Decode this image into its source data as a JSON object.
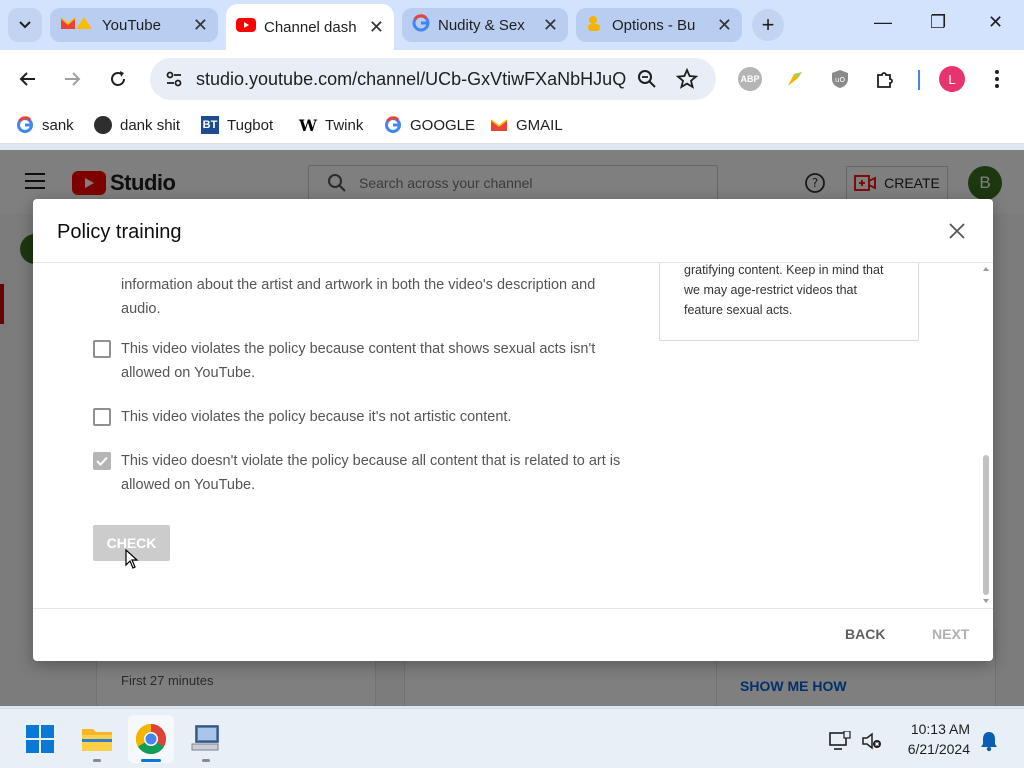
{
  "browser": {
    "tabs": [
      {
        "label": "YouTube",
        "icon": "gmail-youtube-favicon",
        "active": false
      },
      {
        "label": "Channel dash",
        "icon": "youtube-favicon",
        "active": true
      },
      {
        "label": "Nudity & Sex",
        "icon": "google-favicon",
        "active": false
      },
      {
        "label": "Options - Bu",
        "icon": "extension-favicon",
        "active": false
      }
    ],
    "close_glyph": "✕",
    "new_tab_glyph": "+",
    "minimize_glyph": "—",
    "restore_glyph": "❐",
    "window_close_glyph": "✕",
    "url": "studio.youtube.com/channel/UCb-GxVtiwFXaNbHJuQ...",
    "ext_abp_label": "ABP",
    "ext_ub_label": "uO",
    "profile_initial": "L"
  },
  "bookmarks": [
    {
      "label": "sank",
      "icon": "google-icon"
    },
    {
      "label": "dank shit",
      "icon": "dank-icon"
    },
    {
      "label": "Tugbot",
      "icon": "bt-icon",
      "badge": "BT"
    },
    {
      "label": "Twink",
      "icon": "wikipedia-icon",
      "badge": "W"
    },
    {
      "label": "GOOGLE",
      "icon": "google-icon"
    },
    {
      "label": "GMAIL",
      "icon": "gmail-icon"
    }
  ],
  "studio": {
    "logo_word": "Studio",
    "search_placeholder": "Search across your channel",
    "create_label": "CREATE",
    "avatar_initial": "B",
    "first_minutes": "First 27 minutes",
    "show_me_how": "SHOW ME HOW"
  },
  "dialog": {
    "title": "Policy training",
    "continuation_text": "information about the artist and artwork in both the video's description and audio.",
    "options": [
      {
        "label": "This video violates the policy because content that shows sexual acts isn't allowed on YouTube.",
        "checked": false
      },
      {
        "label": "This video violates the policy because it's not artistic content.",
        "checked": false
      },
      {
        "label": "This video doesn't violate the policy because all content that is related to art is allowed on YouTube.",
        "checked": true
      }
    ],
    "check_label": "CHECK",
    "info_text": "gratifying content. Keep in mind that we may age-restrict videos that feature sexual acts.",
    "back_label": "BACK",
    "next_label": "NEXT"
  },
  "taskbar": {
    "time": "10:13 AM",
    "date": "6/21/2024"
  },
  "colors": {
    "youtube_red": "#ff0000",
    "studio_blue": "#065fd4",
    "chrome_tabstrip": "#d3e3fd",
    "profile_pink": "#e8336e"
  }
}
